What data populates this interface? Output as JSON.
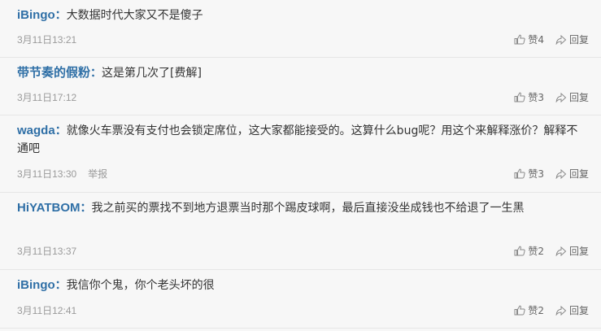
{
  "comments": [
    {
      "user": "iBingo",
      "text": "大数据时代大家又不是傻子",
      "time": "3月11日13:21",
      "likes": "赞4",
      "reply": "回复",
      "report": ""
    },
    {
      "user": "带节奏的假粉",
      "text": "这是第几次了[费解]",
      "time": "3月11日17:12",
      "likes": "赞3",
      "reply": "回复",
      "report": ""
    },
    {
      "user": "wagda",
      "text": "就像火车票没有支付也会锁定席位，这大家都能接受的。这算什么bug呢？用这个来解释涨价？解释不通吧",
      "time": "3月11日13:30",
      "likes": "赞3",
      "reply": "回复",
      "report": "举报"
    },
    {
      "user": "HiYATBOM",
      "text": "我之前买的票找不到地方退票当时那个踢皮球啊，最后直接没坐成钱也不给退了一生黑",
      "time": "3月11日13:37",
      "likes": "赞2",
      "reply": "回复",
      "report": ""
    },
    {
      "user": "iBingo",
      "text": "我信你个鬼，你个老头坏的很",
      "time": "3月11日12:41",
      "likes": "赞2",
      "reply": "回复",
      "report": ""
    }
  ],
  "colon": "：",
  "icons": {
    "like": "thumbs-up-icon",
    "reply": "reply-arrow-icon"
  },
  "colors": {
    "username": "#2f6fa6",
    "text": "#333333",
    "meta": "#9a9a9a",
    "background": "#f7f7f7"
  }
}
